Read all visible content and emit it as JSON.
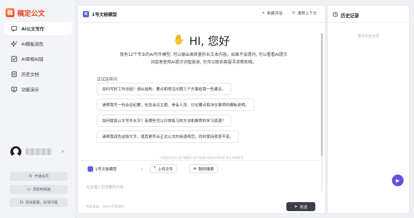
{
  "app": {
    "logo_mark": "稿",
    "logo_text": "稿定公文"
  },
  "sidebar": {
    "items": [
      {
        "label": "AI公文写作",
        "icon": "chat-icon",
        "active": true
      },
      {
        "label": "AI模板润色",
        "icon": "sparkle-icon",
        "active": false
      },
      {
        "label": "AI审核纠错",
        "icon": "check-icon",
        "active": false
      },
      {
        "label": "历史文档",
        "icon": "doc-icon",
        "active": false
      },
      {
        "label": "功能演示",
        "icon": "play-icon",
        "active": false
      }
    ],
    "buttons": [
      {
        "label": "开通会员",
        "icon": "crown-icon"
      },
      {
        "label": "添加到桌面",
        "icon": "desktop-icon"
      },
      {
        "label": "添加客服、反馈问题",
        "icon": "headset-icon"
      }
    ]
  },
  "main": {
    "model_name": "1号文秘模型",
    "new_chat": "新建对话",
    "clear_context": "清除上下文",
    "greeting": "HI, 您好",
    "intro_line1": "我有12个专业的AI写作模型, 可以输出高质量的长文本内容。如果不会提问, 可以看看AI提示",
    "intro_line2": "词或者使用AI提示词智能体, 也可以联系客服寻求帮助哦。",
    "try_label": "试试这样问",
    "suggestions": [
      "如何写好工作总结？请从结构、要点和常见问题三个方面给我一些建议。",
      "请帮我写一份会议纪要，包含会议主题、参会人员、讨论要点和决议事项的模板说明。",
      "如何提高公文写作水平？有哪些可以日常练习的方法和推荐的学习资源？",
      "请帮我润色这段文字，使其更符合正式公文的用语规范，同时保持原意不变。"
    ],
    "disclaimer": "内容由AI生成 请仔细甄别 再严格遵守相关法律法规 禁止违规使用"
  },
  "composer": {
    "model_select": "1号文秘模型",
    "upload": "上传文件",
    "web_search": "联网搜索",
    "placeholder": "在此输入您想要的内容...",
    "hint": "回车发送，Shift+回车换行",
    "send": "发送"
  },
  "history": {
    "title": "历史记录",
    "empty": "暂无历史记录"
  },
  "colors": {
    "accent": "#6a4fe0",
    "brand": "#e8482a",
    "send_bg": "#3d3f48"
  }
}
